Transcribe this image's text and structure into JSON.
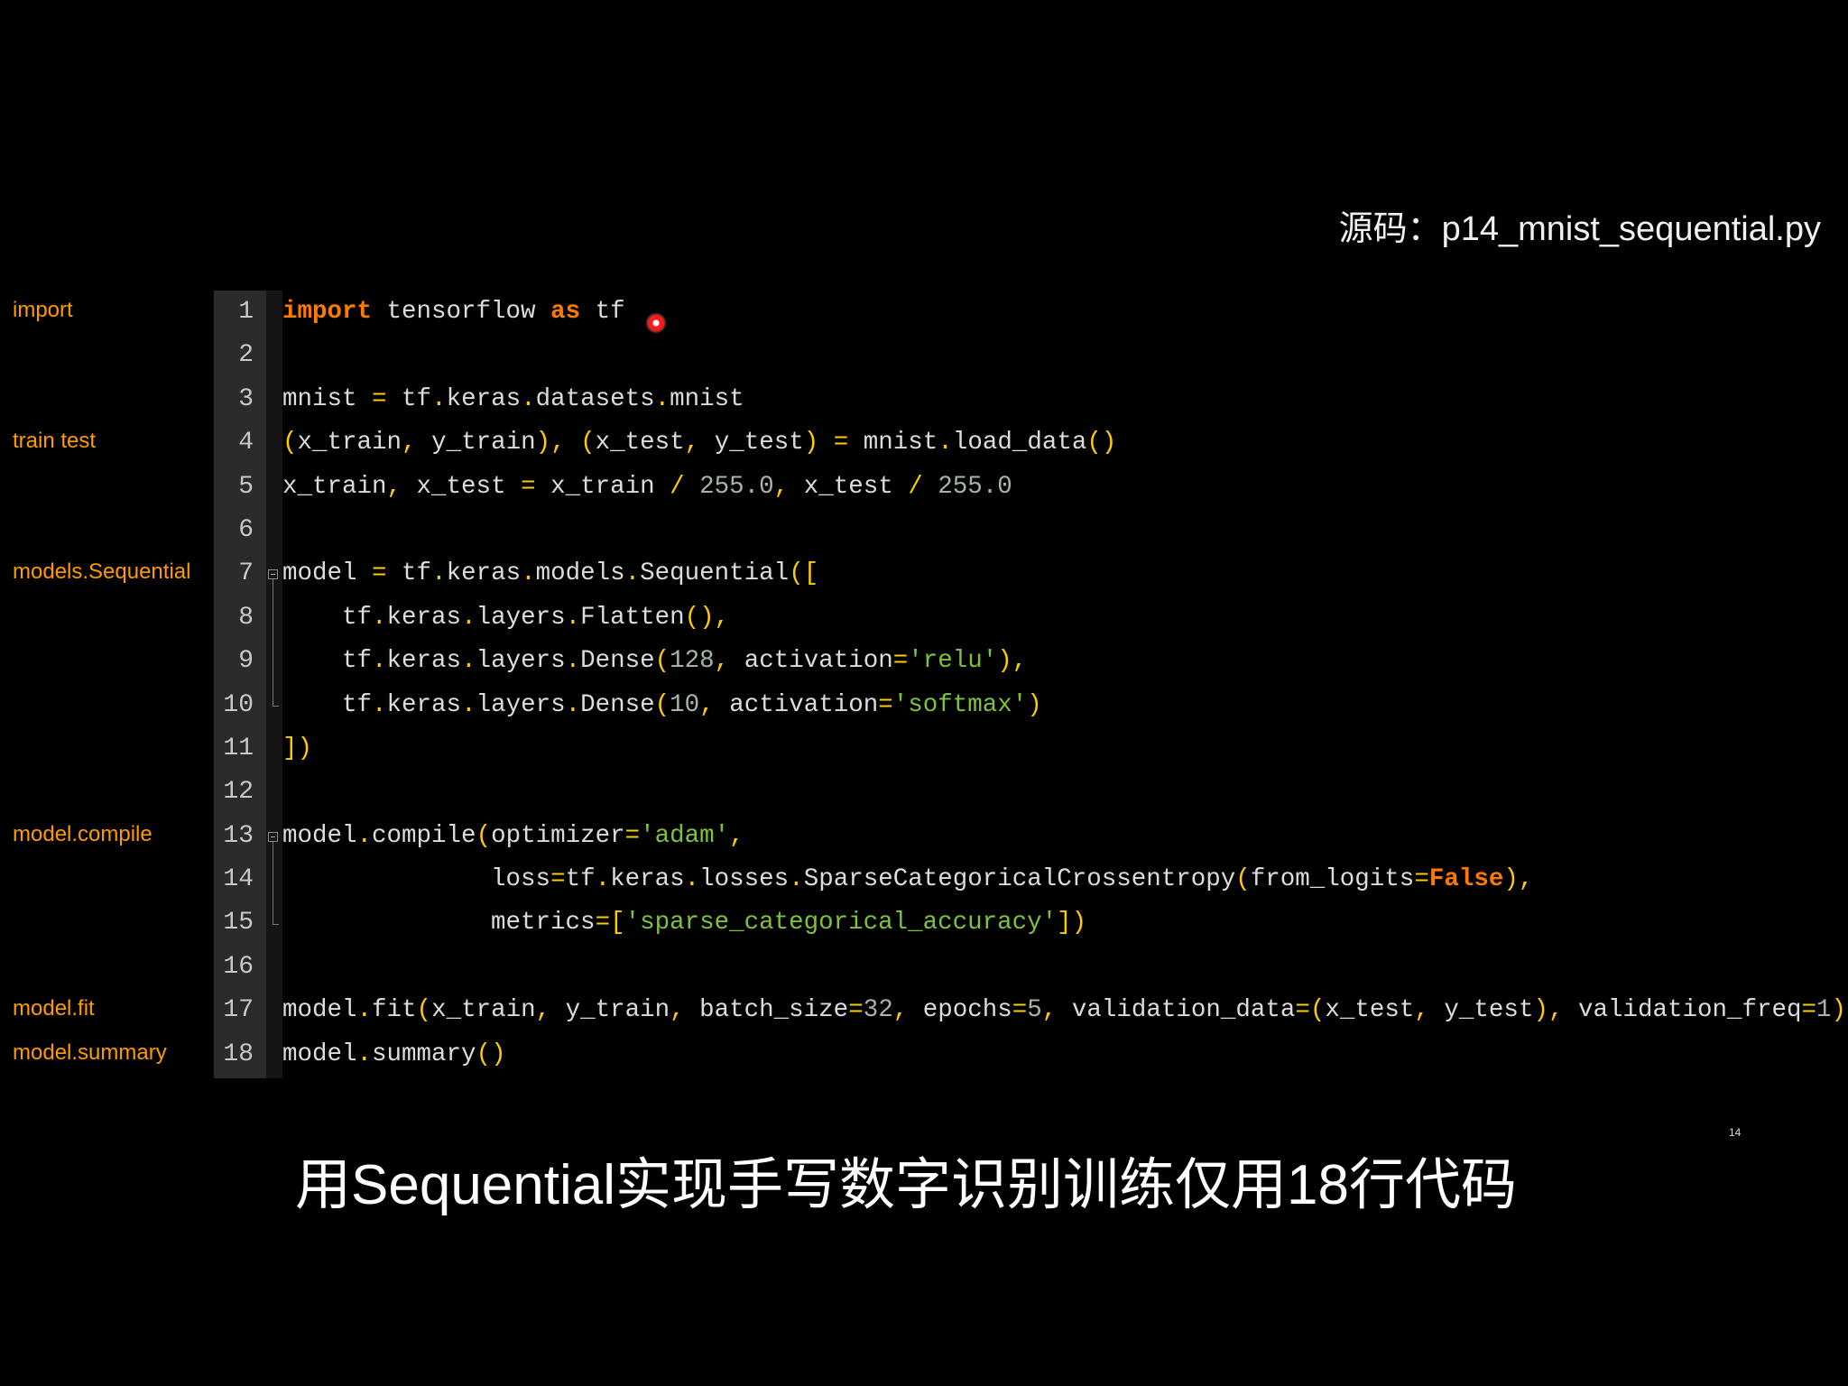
{
  "header": {
    "source_label": "源码：p14_mnist_sequential.py"
  },
  "side_labels": [
    {
      "text": "import",
      "line": 1
    },
    {
      "text": "train  test",
      "line": 4
    },
    {
      "text": "models.Sequential",
      "line": 7
    },
    {
      "text": "model.compile",
      "line": 13
    },
    {
      "text": "model.fit",
      "line": 17
    },
    {
      "text": "model.summary",
      "line": 18
    }
  ],
  "colors": {
    "keyword": "#ff7a00",
    "operator": "#ffcc00",
    "number": "#a6b5a6",
    "string": "#7dc23c",
    "label": "#ff9a00",
    "cursor": "#ff1a1a"
  },
  "code": {
    "folds": [
      {
        "start": 7,
        "end": 10
      },
      {
        "start": 13,
        "end": 15
      }
    ],
    "lines": [
      [
        [
          "k",
          "import"
        ],
        [
          "t",
          " tensorflow "
        ],
        [
          "k",
          "as"
        ],
        [
          "t",
          " tf"
        ]
      ],
      [],
      [
        [
          "t",
          "mnist "
        ],
        [
          "o",
          "="
        ],
        [
          "t",
          " tf"
        ],
        [
          "o",
          "."
        ],
        [
          "t",
          "keras"
        ],
        [
          "o",
          "."
        ],
        [
          "t",
          "datasets"
        ],
        [
          "o",
          "."
        ],
        [
          "t",
          "mnist"
        ]
      ],
      [
        [
          "o",
          "("
        ],
        [
          "t",
          "x_train"
        ],
        [
          "o",
          ","
        ],
        [
          "t",
          " y_train"
        ],
        [
          "o",
          "),"
        ],
        [
          "t",
          " "
        ],
        [
          "o",
          "("
        ],
        [
          "t",
          "x_test"
        ],
        [
          "o",
          ","
        ],
        [
          "t",
          " y_test"
        ],
        [
          "o",
          ")"
        ],
        [
          "t",
          " "
        ],
        [
          "o",
          "="
        ],
        [
          "t",
          " mnist"
        ],
        [
          "o",
          "."
        ],
        [
          "t",
          "load_data"
        ],
        [
          "o",
          "()"
        ]
      ],
      [
        [
          "t",
          "x_train"
        ],
        [
          "o",
          ","
        ],
        [
          "t",
          " x_test "
        ],
        [
          "o",
          "="
        ],
        [
          "t",
          " x_train "
        ],
        [
          "o",
          "/"
        ],
        [
          "t",
          " "
        ],
        [
          "n",
          "255.0"
        ],
        [
          "o",
          ","
        ],
        [
          "t",
          " x_test "
        ],
        [
          "o",
          "/"
        ],
        [
          "t",
          " "
        ],
        [
          "n",
          "255.0"
        ]
      ],
      [],
      [
        [
          "t",
          "model "
        ],
        [
          "o",
          "="
        ],
        [
          "t",
          " tf"
        ],
        [
          "o",
          "."
        ],
        [
          "t",
          "keras"
        ],
        [
          "o",
          "."
        ],
        [
          "t",
          "models"
        ],
        [
          "o",
          "."
        ],
        [
          "t",
          "Sequential"
        ],
        [
          "o",
          "(["
        ]
      ],
      [
        [
          "t",
          "    tf"
        ],
        [
          "o",
          "."
        ],
        [
          "t",
          "keras"
        ],
        [
          "o",
          "."
        ],
        [
          "t",
          "layers"
        ],
        [
          "o",
          "."
        ],
        [
          "t",
          "Flatten"
        ],
        [
          "o",
          "(),"
        ]
      ],
      [
        [
          "t",
          "    tf"
        ],
        [
          "o",
          "."
        ],
        [
          "t",
          "keras"
        ],
        [
          "o",
          "."
        ],
        [
          "t",
          "layers"
        ],
        [
          "o",
          "."
        ],
        [
          "t",
          "Dense"
        ],
        [
          "o",
          "("
        ],
        [
          "n",
          "128"
        ],
        [
          "o",
          ","
        ],
        [
          "t",
          " activation"
        ],
        [
          "o",
          "="
        ],
        [
          "s",
          "'relu'"
        ],
        [
          "o",
          "),"
        ]
      ],
      [
        [
          "t",
          "    tf"
        ],
        [
          "o",
          "."
        ],
        [
          "t",
          "keras"
        ],
        [
          "o",
          "."
        ],
        [
          "t",
          "layers"
        ],
        [
          "o",
          "."
        ],
        [
          "t",
          "Dense"
        ],
        [
          "o",
          "("
        ],
        [
          "n",
          "10"
        ],
        [
          "o",
          ","
        ],
        [
          "t",
          " activation"
        ],
        [
          "o",
          "="
        ],
        [
          "s",
          "'softmax'"
        ],
        [
          "o",
          ")"
        ]
      ],
      [
        [
          "o",
          "])"
        ]
      ],
      [],
      [
        [
          "t",
          "model"
        ],
        [
          "o",
          "."
        ],
        [
          "t",
          "compile"
        ],
        [
          "o",
          "("
        ],
        [
          "t",
          "optimizer"
        ],
        [
          "o",
          "="
        ],
        [
          "s",
          "'adam'"
        ],
        [
          "o",
          ","
        ]
      ],
      [
        [
          "t",
          "              loss"
        ],
        [
          "o",
          "="
        ],
        [
          "t",
          "tf"
        ],
        [
          "o",
          "."
        ],
        [
          "t",
          "keras"
        ],
        [
          "o",
          "."
        ],
        [
          "t",
          "losses"
        ],
        [
          "o",
          "."
        ],
        [
          "t",
          "SparseCategoricalCrossentropy"
        ],
        [
          "o",
          "("
        ],
        [
          "t",
          "from_logits"
        ],
        [
          "o",
          "="
        ],
        [
          "k",
          "False"
        ],
        [
          "o",
          "),"
        ]
      ],
      [
        [
          "t",
          "              metrics"
        ],
        [
          "o",
          "=["
        ],
        [
          "s",
          "'sparse_categorical_accuracy'"
        ],
        [
          "o",
          "])"
        ]
      ],
      [],
      [
        [
          "t",
          "model"
        ],
        [
          "o",
          "."
        ],
        [
          "t",
          "fit"
        ],
        [
          "o",
          "("
        ],
        [
          "t",
          "x_train"
        ],
        [
          "o",
          ","
        ],
        [
          "t",
          " y_train"
        ],
        [
          "o",
          ","
        ],
        [
          "t",
          " batch_size"
        ],
        [
          "o",
          "="
        ],
        [
          "n",
          "32"
        ],
        [
          "o",
          ","
        ],
        [
          "t",
          " epochs"
        ],
        [
          "o",
          "="
        ],
        [
          "n",
          "5"
        ],
        [
          "o",
          ","
        ],
        [
          "t",
          " validation_data"
        ],
        [
          "o",
          "=("
        ],
        [
          "t",
          "x_test"
        ],
        [
          "o",
          ","
        ],
        [
          "t",
          " y_test"
        ],
        [
          "o",
          "),"
        ],
        [
          "t",
          " validation_freq"
        ],
        [
          "o",
          "="
        ],
        [
          "n",
          "1"
        ],
        [
          "o",
          ")"
        ]
      ],
      [
        [
          "t",
          "model"
        ],
        [
          "o",
          "."
        ],
        [
          "t",
          "summary"
        ],
        [
          "o",
          "()"
        ]
      ]
    ]
  },
  "subtitle": "用Sequential实现手写数字识别训练仅用18行代码",
  "page_number": "14"
}
